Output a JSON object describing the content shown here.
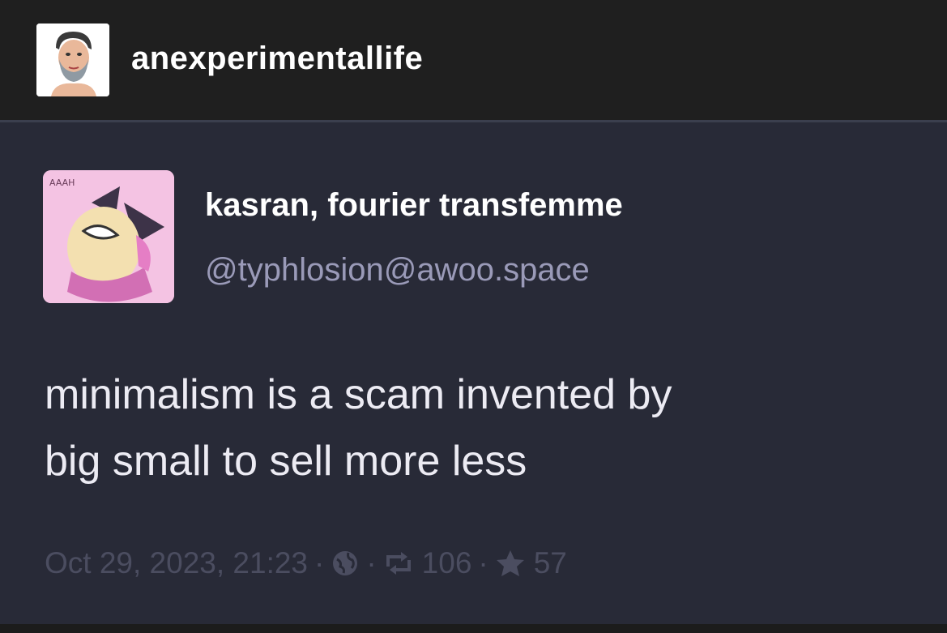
{
  "header": {
    "username": "anexperimentallife",
    "avatar_icon": "user-avatar-icon"
  },
  "post": {
    "display_name": "kasran, fourier transfemme",
    "handle": "@typhlosion@awoo.space",
    "avatar_icon": "profile-avatar-icon",
    "text_lines": [
      "minimalism is a scam invented by",
      "big small to sell more less"
    ],
    "timestamp": "Oct 29, 2023, 21:23",
    "separator": "·",
    "visibility_icon": "globe-icon",
    "boost_icon": "boost-icon",
    "boost_count": "106",
    "favourite_icon": "star-icon",
    "favourite_count": "57"
  },
  "colors": {
    "header_bg": "#1f1f1f",
    "post_bg": "#282a37",
    "text": "#ecebf3",
    "handle": "#9a9ab8",
    "meta": "#4b4d60"
  }
}
